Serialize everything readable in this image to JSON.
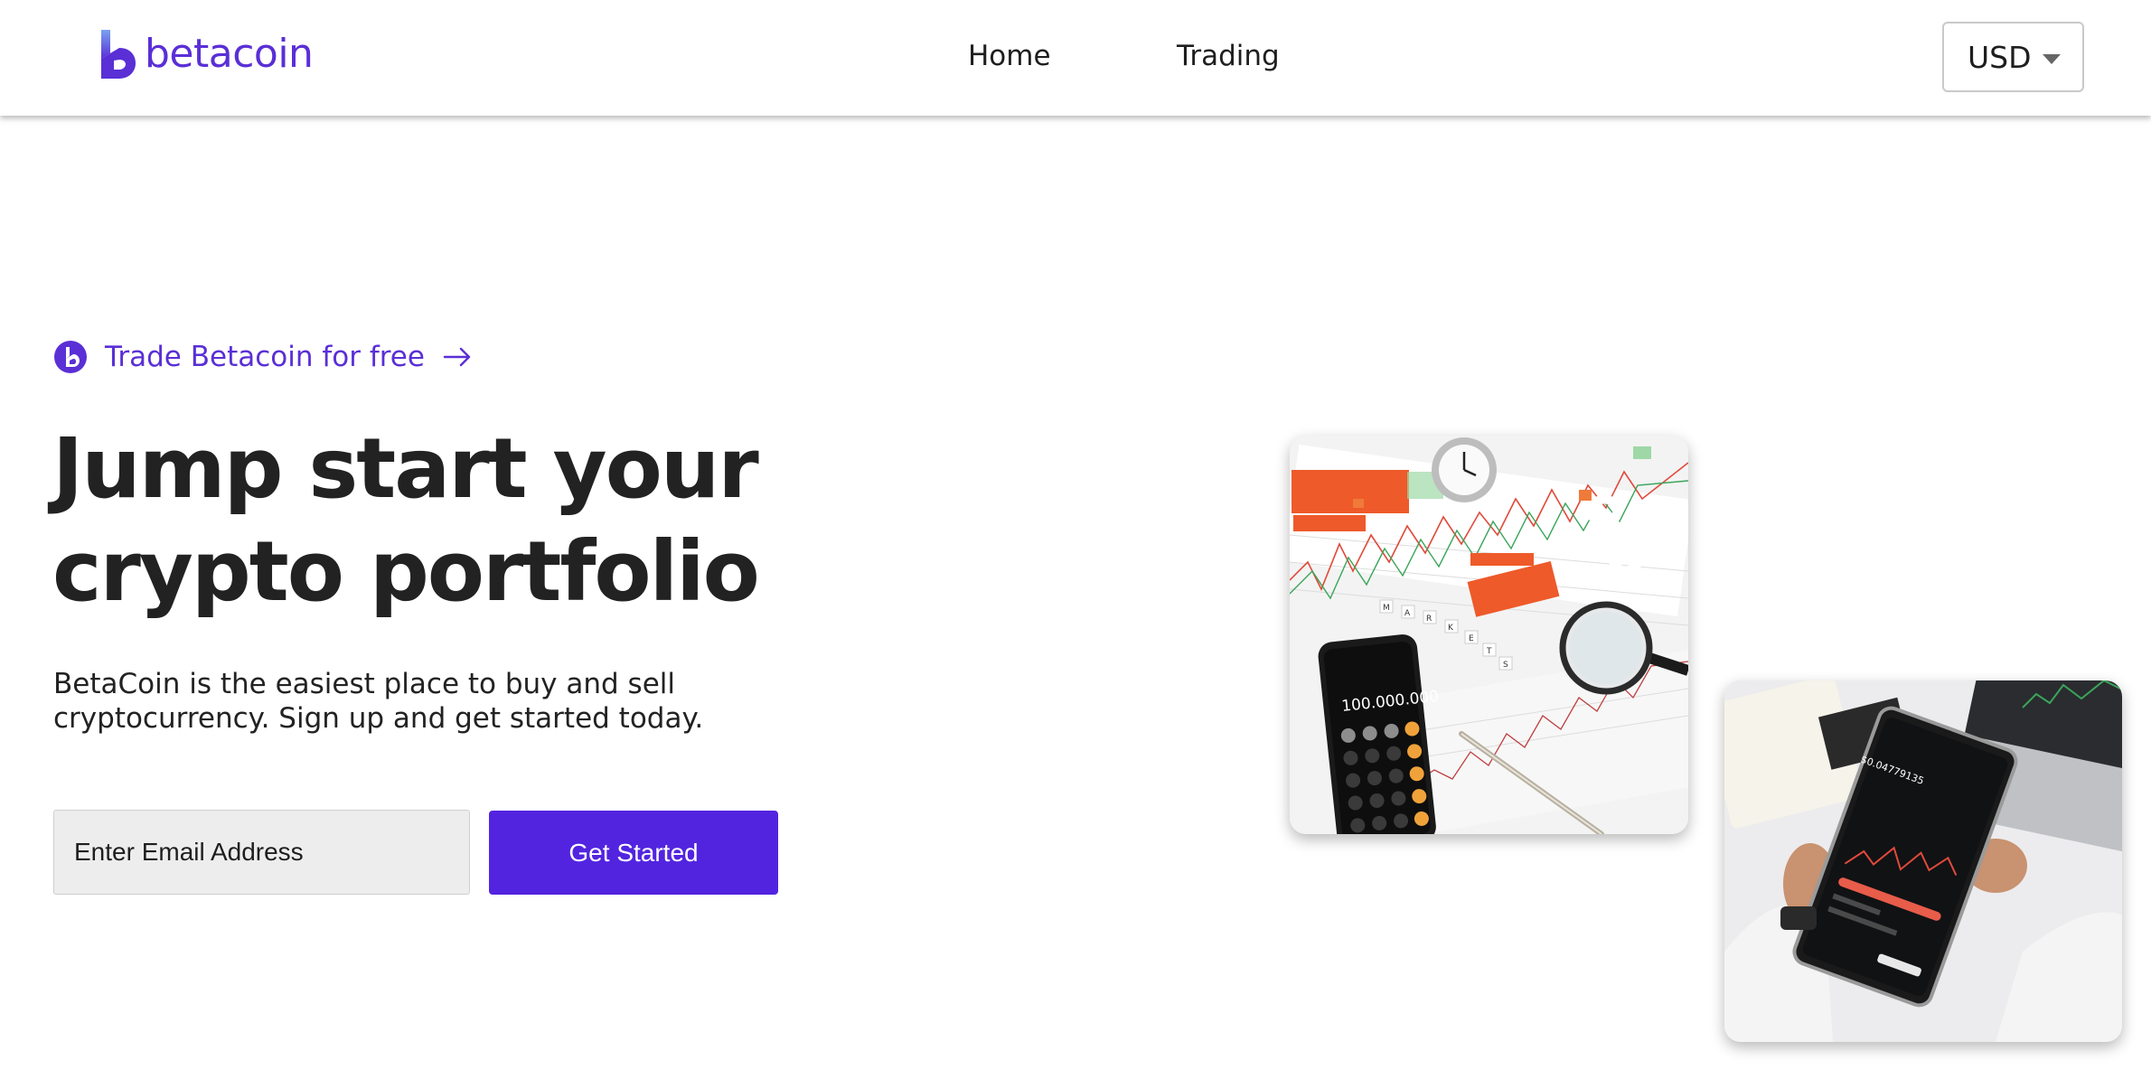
{
  "header": {
    "logo_text": "betacoin",
    "nav": [
      {
        "label": "Home"
      },
      {
        "label": "Trading"
      }
    ],
    "currency_select": {
      "value": "USD"
    }
  },
  "hero": {
    "badge_text": "Trade Betacoin for free",
    "headline_lines": [
      "Jump start your",
      "crypto portfolio"
    ],
    "subtext_lines": [
      "BetaCoin is the easiest place to buy and sell",
      "cryptocurrency. Sign up and get started today."
    ],
    "email_placeholder": "Enter Email Address",
    "cta_label": "Get Started"
  },
  "photos": {
    "photo1": {
      "phone_display": "100.000.000",
      "dice_letters": [
        "M",
        "A",
        "R",
        "K",
        "E",
        "T",
        "S"
      ]
    },
    "photo2": {
      "tablet_balance": "$0.04779135"
    }
  },
  "colors": {
    "brand": "#5a2fd6",
    "cta": "#5224e0",
    "text": "#222222",
    "input_bg": "#ededed"
  }
}
